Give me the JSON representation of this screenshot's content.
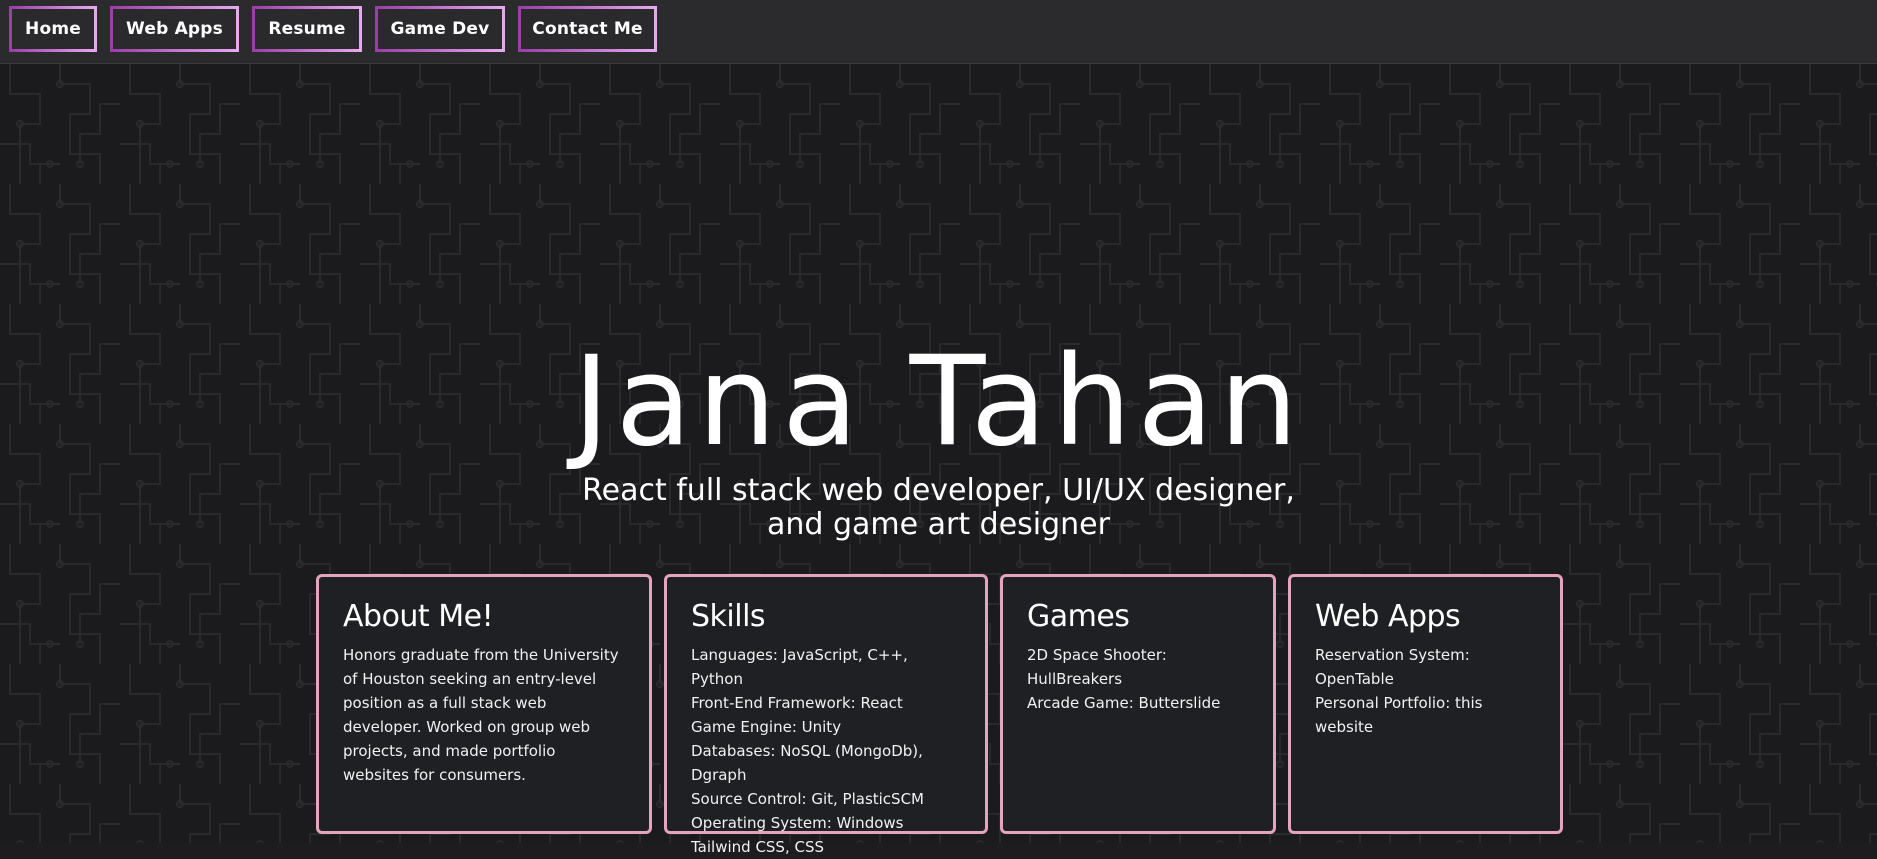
{
  "nav": {
    "items": [
      {
        "label": "Home"
      },
      {
        "label": "Web Apps"
      },
      {
        "label": "Resume"
      },
      {
        "label": "Game Dev"
      },
      {
        "label": "Contact Me"
      }
    ]
  },
  "hero": {
    "name": "Jana Tahan",
    "tagline": "React full stack web developer, UI/UX designer, and game art designer"
  },
  "cards": [
    {
      "title": "About Me!",
      "body": "Honors graduate from the University of Houston seeking an entry-level position as a full stack web developer. Worked on group web projects, and made portfolio websites for consumers."
    },
    {
      "title": "Skills",
      "lines": [
        "Languages: JavaScript, C++, Python",
        "Front-End Framework: React",
        "Game Engine: Unity",
        "Databases: NoSQL (MongoDb), Dgraph",
        "Source Control: Git, PlasticSCM",
        "Operating System: Windows",
        "Tailwind CSS, CSS"
      ]
    },
    {
      "title": "Games",
      "lines": [
        "2D Space Shooter: HullBreakers",
        "Arcade Game: Butterslide"
      ]
    },
    {
      "title": "Web Apps",
      "lines": [
        "Reservation System: OpenTable",
        "Personal Portfolio: this website"
      ]
    }
  ],
  "colors": {
    "nav_border": "#c76fd6",
    "card_border": "#e7a2bd",
    "background": "#1b1b1d"
  }
}
